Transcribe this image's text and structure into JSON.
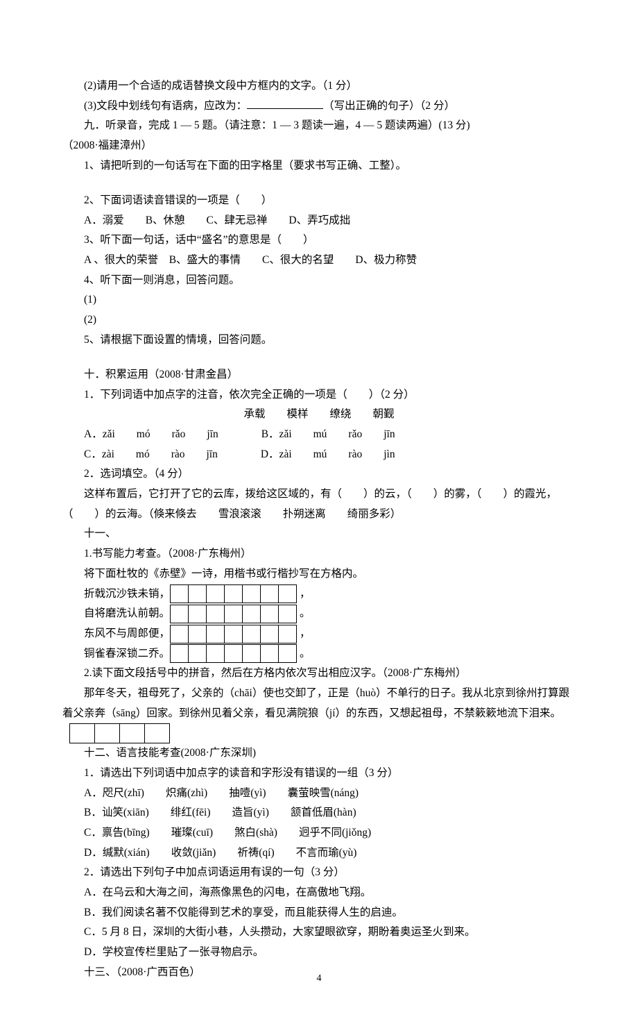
{
  "top": {
    "line1": "(2)请用一个合适的成语替换文段中方框内的文字。（1 分）",
    "line2a": "(3)文段中划线句有语病，应改为：",
    "line2b": "（写出正确的句子）（2 分）"
  },
  "sec9": {
    "title": "九．听录音，完成 1 — 5 题。（请注意：1 — 3 题读一遍，4 — 5 题读两遍）(13 分)",
    "source": "（2008·福建漳州）",
    "q1": "1、请把听到的一句话写在下面的田字格里（要求书写正确、工整）。",
    "q2": "2、下面词语读音错误的一项是（　　）",
    "q2opts": "A．溺爱　　B、休憩　　C、肆无忌禅　　D、弄巧成拙",
    "q3": "3、听下面一句话，话中“盛名”的意思是（　　）",
    "q3opts": "A 、很大的荣誉　B、盛大的事情　　C、很大的名望　　D、极力称赞",
    "q4": "4、听下面一则消息，回答问题。",
    "q4a": "(1)",
    "q4b": "(2)",
    "q5": "5、请根据下面设置的情境，回答问题。"
  },
  "sec10": {
    "title": "十．积累运用（2008·甘肃金昌）",
    "q1": "1．下列词语中加点字的注音，依次完全正确的一项是（　　）（2 分）",
    "words": "承载　　模样　　缭绕　　朝觐",
    "optA": "A．zǎi　　mó　　rǎo　　jīn　　　　B．zǎi　　mú　　rǎo　　jīn",
    "optC": "C．zài　　mó　　rào　　jīn　　　　D．zài　　mú　　rào　　jìn",
    "q2": "2．选词填空。（4 分）",
    "q2text": "这样布置后，它打开了它的云库，拨给这区域的，有（　　）的云，（　　）的雾，（　　）的霞光，（　　）的云海。（倏来倏去　　雪浪滚滚　　扑朔迷离　　绮丽多彩）"
  },
  "sec11": {
    "title": "十一、",
    "q1": "1.书写能力考查。（2008·广东梅州）",
    "q1sub": "将下面杜牧的《赤壁》一诗，用楷书或行楷抄写在方格内。",
    "poem1": "折戟沉沙铁未销，",
    "poem2": "自将磨洗认前朝。",
    "poem3": "东风不与周郎便，",
    "poem4": "铜雀春深锁二乔。",
    "q2": "2.读下面文段括号中的拼音，然后在方格内依次写出相应汉字。（2008·广东梅州）",
    "passage": "那年冬天，祖母死了，父亲的（chāi）使也交卸了，正是（huò）不单行的日子。我从北京到徐州打算跟着父亲奔（sāng）回家。到徐州见着父亲，看见满院狼（jí）的东西，又想起祖母，不禁簌簌地流下泪来。"
  },
  "sec12": {
    "title": "十二、语言技能考查(2008·广东深圳)",
    "q1": "1．请选出下列词语中加点字的读音和字形没有错误的一组（3 分）",
    "optA": "A．咫尺(zhī)　　炽痛(zhì)　　抽噎(yì)　　囊萤映雪(náng)",
    "optB": "B．讪笑(xiān)　　绯红(fēi)　　造旨(yì)　　颔首低眉(hàn)",
    "optC": "C．禀告(bīng)　　璀璨(cuī)　　煞白(shà)　　迥乎不同(jiǒng)",
    "optD": "D．缄默(xián)　　收敛(jiǎn)　　祈祷(qí)　　不言而瑜(yù)",
    "q2": "2．请选出下列句子中加点词语运用有误的一句（3 分）",
    "q2A": "A．在乌云和大海之间，海燕像黑色的闪电，在高傲地飞翔。",
    "q2B": "B．我们阅读名著不仅能得到艺术的享受，而且能获得人生的启迪。",
    "q2C": "C．5 月 8 日，深圳的大街小巷，人头攒动，大家望眼欲穿，期盼着奥运圣火到来。",
    "q2D": "D．学校宣传栏里贴了一张寻物启示。"
  },
  "sec13": {
    "title": "十三、（2008·广西百色）"
  },
  "pageNumber": "4"
}
